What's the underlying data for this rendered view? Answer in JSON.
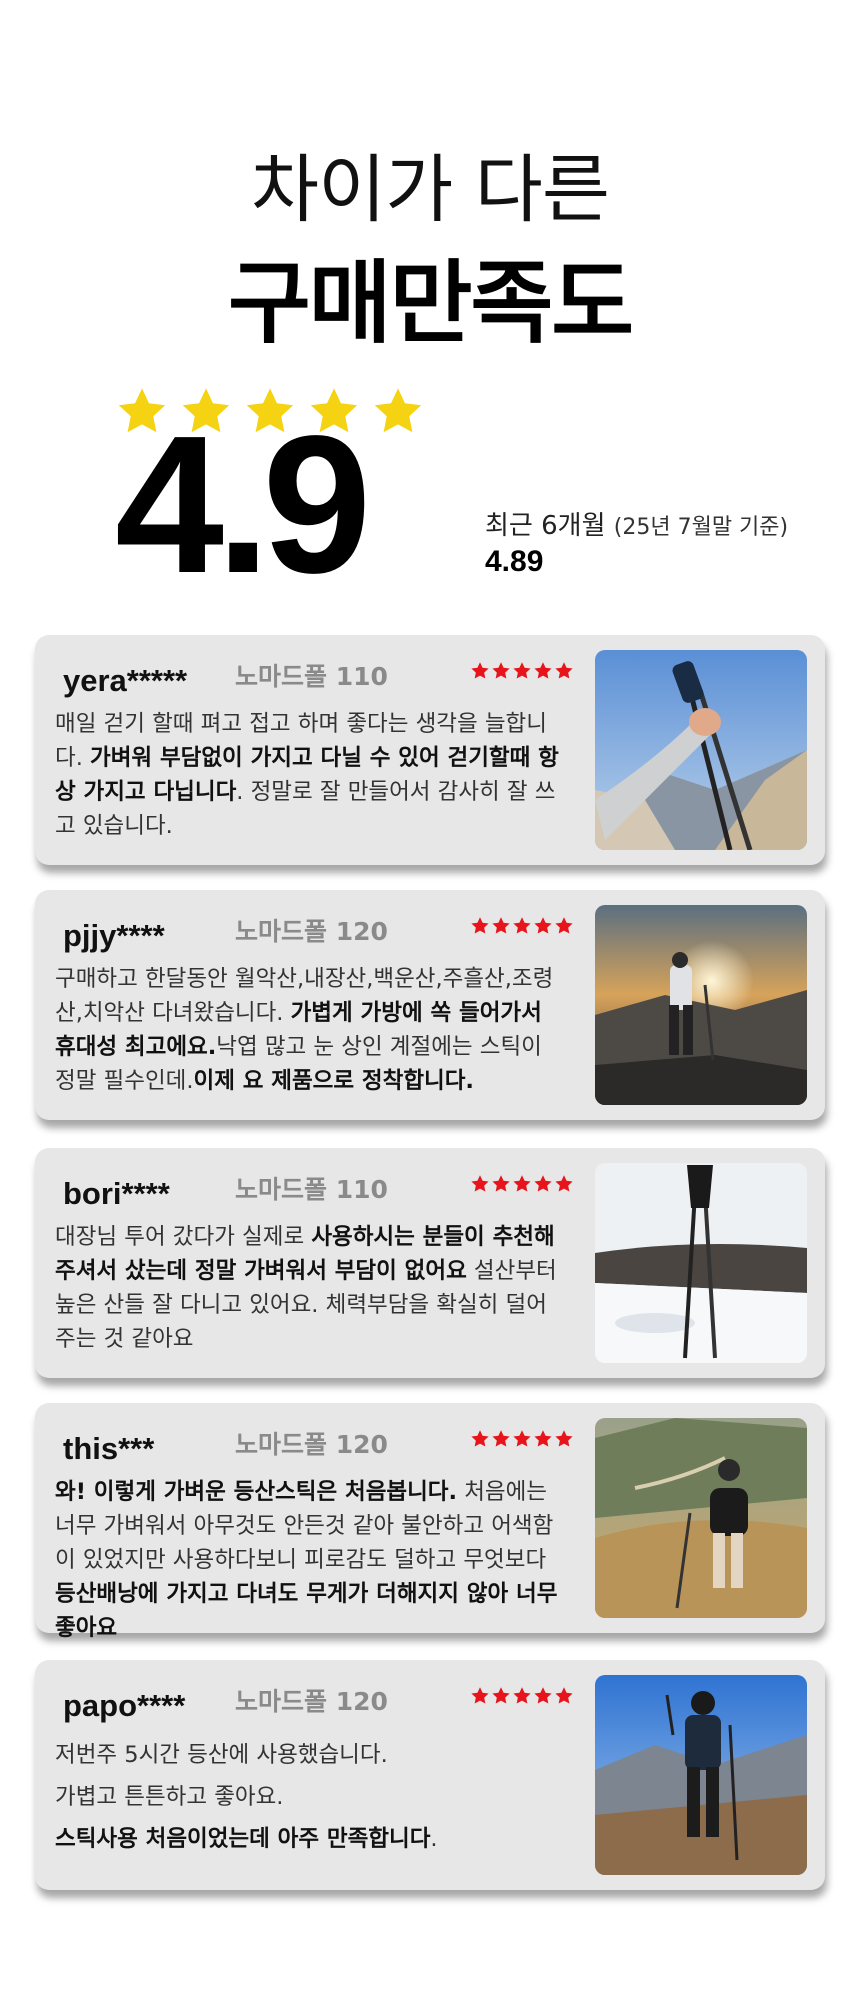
{
  "header": {
    "line1": "차이가 다른",
    "line2": "구매만족도"
  },
  "rating": {
    "score": "4.9",
    "star_count": 5,
    "star_color": "#f5d312",
    "recent_label": "최근 6개월",
    "recent_note": "(25년 7월말 기준)",
    "recent_score": "4.89"
  },
  "reviews": [
    {
      "user": "yera*****",
      "product": "노마드폴 110",
      "stars": 5,
      "star_color": "#e8141c",
      "body": [
        {
          "text": "매일 걷기 할때 펴고 접고 하며 좋다는 생각을 늘합니다. ",
          "bold": false
        },
        {
          "text": "가벼워 부담없이 가지고 다닐 수 있어 걷기할때 항상 가지고 다닙니다",
          "bold": true
        },
        {
          "text": ". 정말로 잘 만들어서 감사히 잘 쓰고 있습니다.",
          "bold": false
        }
      ],
      "photo": "hand-holding-poles-mountain-photo"
    },
    {
      "user": "pjjy****",
      "product": "노마드폴 120",
      "stars": 5,
      "star_color": "#e8141c",
      "body": [
        {
          "text": "구매하고 한달동안 월악산,내장산,백운산,주흘산,조령산,치악산 다녀왔습니다. ",
          "bold": false
        },
        {
          "text": "가볍게 가방에 쏙 들어가서 휴대성 최고에요.",
          "bold": true
        },
        {
          "text": "낙엽 많고 눈 상인 계절에는 스틱이 정말 필수인데.",
          "bold": false
        },
        {
          "text": "이제 요 제품으로 정착합니다.",
          "bold": true
        }
      ],
      "photo": "hiker-sunset-photo"
    },
    {
      "user": "bori****",
      "product": "노마드폴 110",
      "stars": 5,
      "star_color": "#e8141c",
      "body": [
        {
          "text": "대장님 투어 갔다가 실제로 ",
          "bold": false
        },
        {
          "text": "사용하시는 분들이 추천해주셔서 샀는데 정말 가벼워서 부담이 없어요",
          "bold": true
        },
        {
          "text": " 설산부터 높은 산들 잘 다니고 있어요. 체력부담을 확실히 덜어주는 것 같아요",
          "bold": false
        }
      ],
      "photo": "poles-in-snow-photo"
    },
    {
      "user": "this***",
      "product": "노마드폴 120",
      "stars": 5,
      "star_color": "#e8141c",
      "body": [
        {
          "text": "와! 이렇게 가벼운 등산스틱은 처음봅니다.",
          "bold": true
        },
        {
          "text": " 처음에는 너무 가벼워서 아무것도 안든것 같아 불안하고 어색함이 있었지만 사용하다보니 피로감도 덜하고 무엇보다 ",
          "bold": false
        },
        {
          "text": "등산배낭에 가지고 다녀도 무게가 더해지지 않아 너무 좋아요",
          "bold": true
        }
      ],
      "photo": "hiker-grass-slope-photo"
    },
    {
      "user": "papo****",
      "product": "노마드폴 120",
      "stars": 5,
      "star_color": "#e8141c",
      "body_lines": [
        {
          "text": "저번주 5시간 등산에 사용했습니다.",
          "bold": false
        },
        {
          "text": "가볍고 튼튼하고 좋아요.",
          "bold": false
        },
        {
          "text": "스틱사용 처음이었는데 아주 만족합니다",
          "bold": true,
          "tail": "."
        }
      ],
      "photo": "hiker-mountain-ridge-photo"
    }
  ]
}
